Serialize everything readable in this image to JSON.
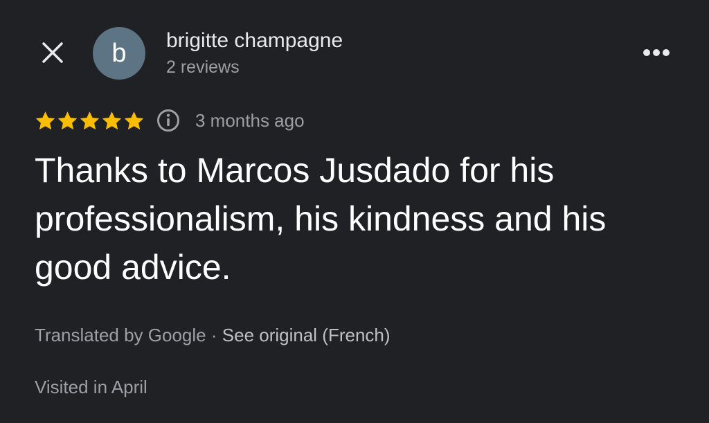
{
  "header": {
    "avatar_letter": "b",
    "author_name": "brigitte champagne",
    "review_count": "2 reviews",
    "close_icon": "close-icon",
    "more_icon": "more-horiz-icon"
  },
  "rating": {
    "stars": 5,
    "max_stars": 5,
    "star_color": "#fbbc04",
    "info_icon": "info-icon",
    "time_ago": "3 months ago"
  },
  "review": {
    "text": "Thanks to Marcos Jusdado for his professionalism, his kindness and his good advice."
  },
  "translation": {
    "translated_by": "Translated by Google",
    "separator": "·",
    "see_original": "See original (French)"
  },
  "visited": "Visited in April",
  "colors": {
    "background": "#202124",
    "avatar": "#5c7483",
    "primary_text": "#ffffff",
    "secondary_text": "#9aa0a6"
  }
}
